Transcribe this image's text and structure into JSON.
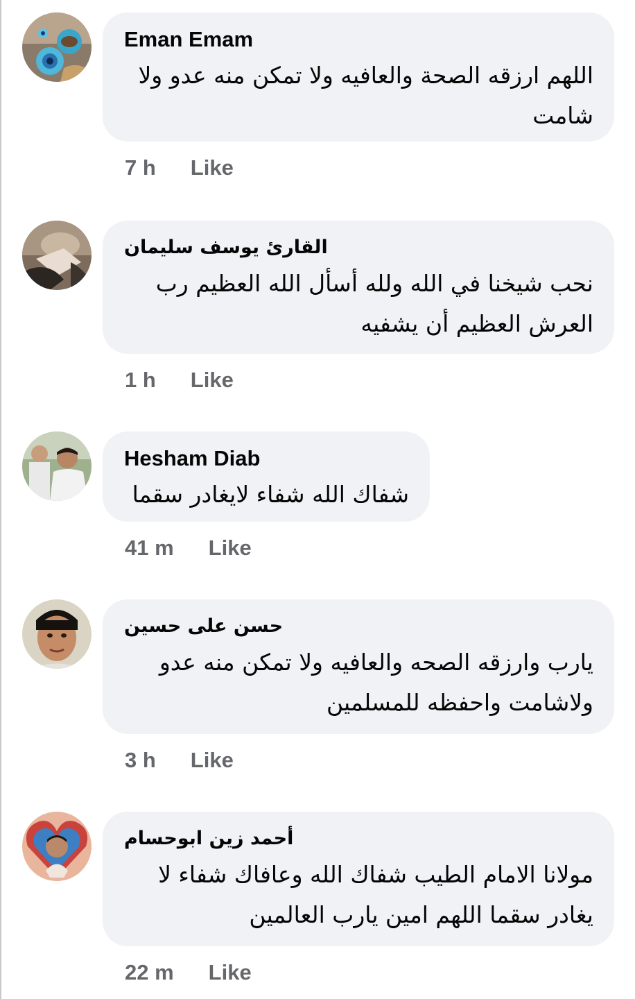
{
  "comments": [
    {
      "author": "Eman Emam",
      "text": "اللهم ارزقه الصحة والعافيه ولا تمكن منه عدو ولا شامت",
      "time": "7 h",
      "like": "Like"
    },
    {
      "author": "القارئ يوسف سليمان",
      "text": "نحب شيخنا في الله ولله أسأل الله العظيم رب العرش العظيم أن يشفيه",
      "time": "1 h",
      "like": "Like"
    },
    {
      "author": "Hesham Diab",
      "text": "شفاك الله شفاء لايغادر سقما",
      "time": "41 m",
      "like": "Like"
    },
    {
      "author": "حسن على حسين",
      "text": "يارب وارزقه الصحه والعافيه ولا تمكن منه عدو ولاشامت واحفظه للمسلمين",
      "time": "3 h",
      "like": "Like"
    },
    {
      "author": "أحمد زين ابوحسام",
      "text": "مولانا الامام الطيب شفاك الله وعافاك شفاء لا يغادر سقما اللهم امين يارب العالمين",
      "time": "22 m",
      "like": "Like"
    }
  ],
  "colors": {
    "bubble": "#f0f2f5",
    "meta": "#65676b",
    "text": "#050505"
  }
}
